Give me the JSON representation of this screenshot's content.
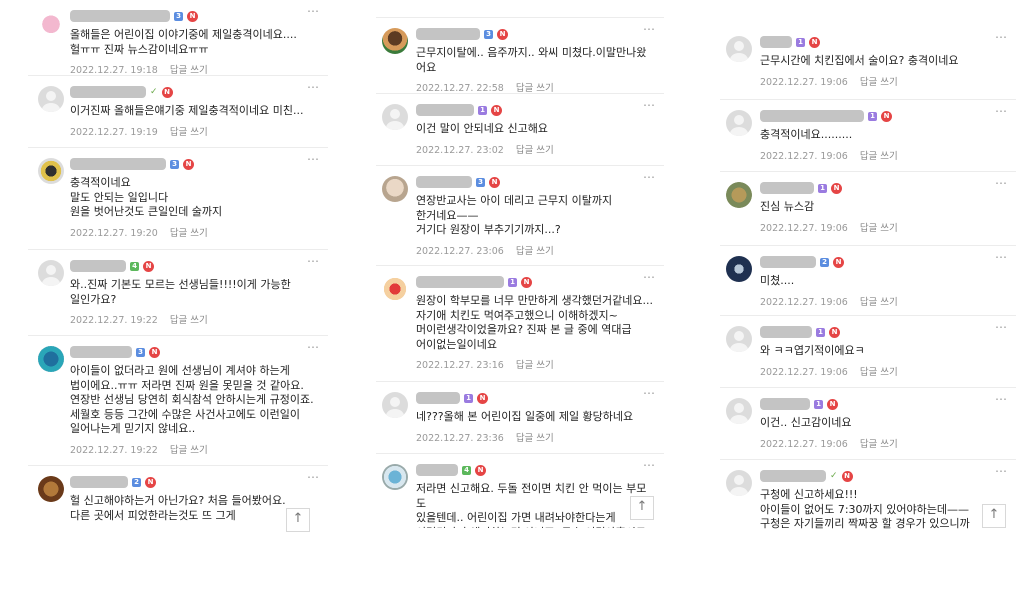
{
  "reply_label": "답글 쓰기",
  "more_icon": "⋯",
  "top_icon": "↑",
  "columns": [
    {
      "comments": [
        {
          "text": "올해들은 어린이집 이야기중에 제일충격이네요....\n헐ㅠㅠ 진짜 뉴스감이네요ㅠㅠ",
          "date": "2022.12.27. 19:18"
        },
        {
          "text": "이거진짜 올해들은얘기중 제일충격적이네요 미친...",
          "date": "2022.12.27. 19:19"
        },
        {
          "text": "충격적이네요\n말도 안되는 일입니다\n원을 벗어난것도 큰일인데 술까지",
          "date": "2022.12.27. 19:20"
        },
        {
          "text": "와..진짜 기본도 모르는 선생님들!!!!이게 가능한\n일인가요?",
          "date": "2022.12.27. 19:22"
        },
        {
          "text": "아이들이 없더라고 원에 선생님이 계셔야 하는게\n법이에요..ㅠㅠ 저라면 진짜 원을 못믿을 것 같아요.\n연장반 선생님 당연히 회식참석 안하시는게 규정이죠.\n세월호 등등 그간에 수많은 사건사고에도 이런일이\n일어나는게 믿기지 않네요..",
          "date": "2022.12.27. 19:22"
        },
        {
          "text": "헐 신고해야하는거 아닌가요? 처음 들어봤어요.\n다른 곳에서 피었한라는것도 뜨 그게",
          "date": ""
        }
      ]
    },
    {
      "comments": [
        {
          "text": "근무지이탈에.. 음주까지.. 와씨 미쳤다.이말만나왔어요",
          "date": "2022.12.27. 22:58"
        },
        {
          "text": "이건 말이 안되네요 신고해요",
          "date": "2022.12.27. 23:02"
        },
        {
          "text": "연장반교사는 아이 데리고 근무지 이탈까지\n한거네요——\n거기다 원장이 부추기기까지...?",
          "date": "2022.12.27. 23:06"
        },
        {
          "text": "원장이 학부모를 너무 만만하게 생각했던거같네요...\n자기애 치킨도 먹여주고했으니 이해하겠지~\n머이런생각이었을까요? 진짜 본 글 중에 역대급\n어이없는일이네요",
          "date": "2022.12.27. 23:16"
        },
        {
          "text": "네???올해 본 어린이집 일중에 제일 황당하네요",
          "date": "2022.12.27. 23:36"
        },
        {
          "text": "저라면 신고해요. 두돌 전이면 치킨 안 먹이는 부모도\n있을텐데.. 어린이집 가면 내려놔야한다는게\n이런것까지 얘기하는건 아니죠. 무슨 여덟아홉시로",
          "date": ""
        }
      ]
    },
    {
      "comments": [
        {
          "text": "근무시간에 치킨집에서 술이요? 충격이네요",
          "date": "2022.12.27. 19:06"
        },
        {
          "text": "충격적이네요.........",
          "date": "2022.12.27. 19:06"
        },
        {
          "text": "진심 뉴스감",
          "date": "2022.12.27. 19:06"
        },
        {
          "text": "미쳤....",
          "date": "2022.12.27. 19:06"
        },
        {
          "text": "와 ㅋㅋ엽기적이에요ㅋ",
          "date": "2022.12.27. 19:06"
        },
        {
          "text": "이건.. 신고감이네요",
          "date": "2022.12.27. 19:06"
        },
        {
          "text": "구청에 신고하세요!!!\n아이들이 없어도 7:30까지 있어야하는데——\n구청은 자기들끼리 짝짜꿍 할 경우가 있으니까",
          "date": ""
        }
      ]
    }
  ]
}
